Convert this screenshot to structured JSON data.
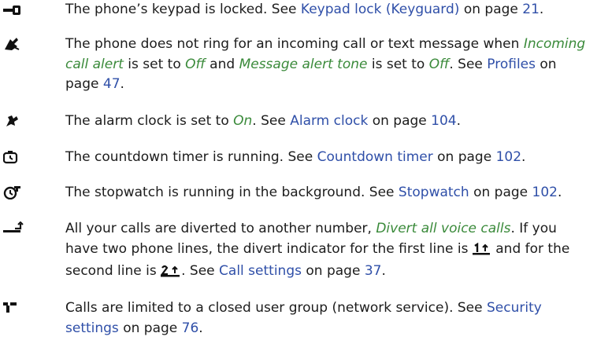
{
  "items": [
    {
      "icon": "keypad-lock-icon",
      "t1": "The phone’s keypad is locked. See ",
      "link1": "Keypad lock (Keyguard)",
      "t2": " on page ",
      "page": "21",
      "t3": "."
    },
    {
      "icon": "silent-mode-icon",
      "t1": "The phone does not ring for an incoming call or text message when ",
      "em1": "Incoming call alert",
      "t2": " is set to ",
      "em2": "Off",
      "t3": " and ",
      "em3": "Message alert tone",
      "t4": " is set to ",
      "em4": "Off",
      "t5": ". See ",
      "link1": "Profiles",
      "t6": " on page ",
      "page": "47",
      "t7": "."
    },
    {
      "icon": "alarm-clock-icon",
      "t1": "The alarm clock is set to ",
      "em1": "On",
      "t2": ". See ",
      "link1": "Alarm clock",
      "t3": " on page ",
      "page": "104",
      "t4": "."
    },
    {
      "icon": "countdown-timer-icon",
      "t1": "The countdown timer is running. See ",
      "link1": "Countdown timer",
      "t2": " on page ",
      "page": "102",
      "t3": "."
    },
    {
      "icon": "stopwatch-icon",
      "t1": "The stopwatch is running in the background. See ",
      "link1": "Stopwatch",
      "t2": " on page ",
      "page": "102",
      "t3": "."
    },
    {
      "icon": "call-divert-icon",
      "t1": "All your calls are diverted to another number, ",
      "em1": "Divert all voice calls",
      "t2": ". If you have two phone lines, the divert indicator for the first line is ",
      "t3": " and for the second line is ",
      "t4": ". See ",
      "link1": "Call settings",
      "t5": " on page ",
      "page": "37",
      "t6": "."
    },
    {
      "icon": "closed-user-group-icon",
      "t1": "Calls are limited to a closed user group (network service). See ",
      "link1": "Security settings",
      "t2": " on page ",
      "page": "76",
      "t3": "."
    }
  ],
  "colors": {
    "link": "#2f4fa8",
    "emphasis": "#3a8a3a",
    "text": "#1c1c1c"
  }
}
